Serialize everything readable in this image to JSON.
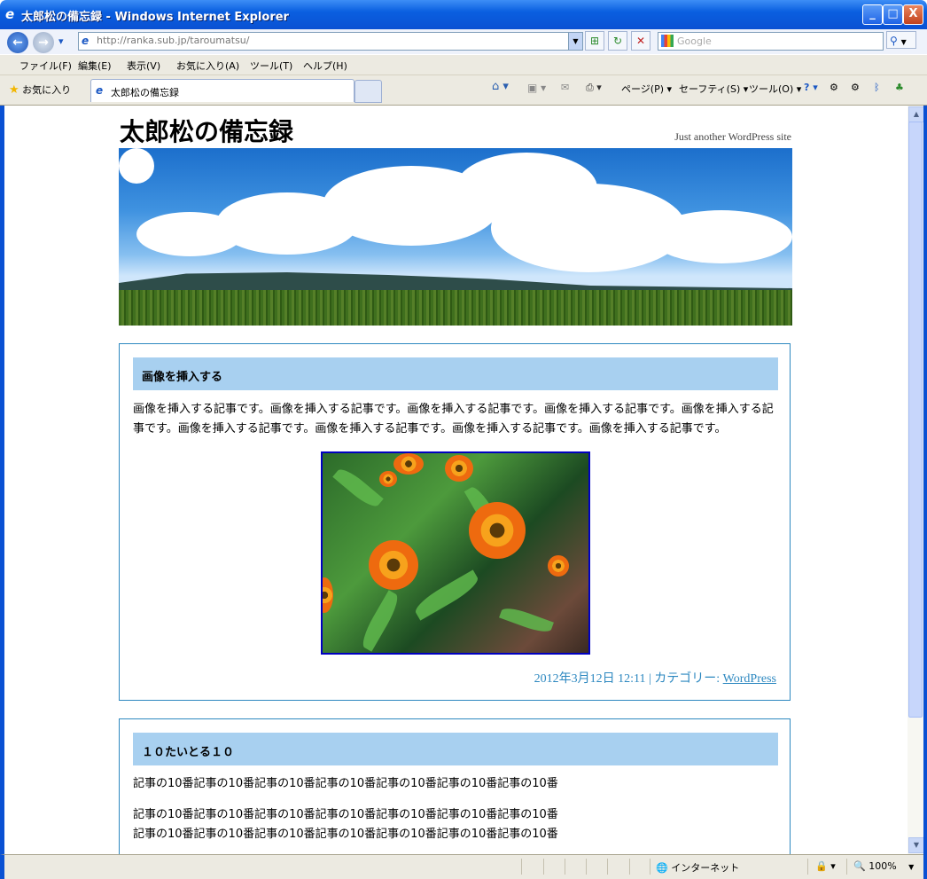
{
  "window": {
    "title": "太郎松の備忘録 - Windows Internet Explorer",
    "ie_logo": "e",
    "min": "_",
    "max": "□",
    "close": "X"
  },
  "nav": {
    "back": "←",
    "forward": "→",
    "history": "▾",
    "address": "http://ranka.sub.jp/taroumatsu/",
    "search_placeholder": "Google"
  },
  "menu": [
    "ファイル(F)",
    "編集(E)",
    "表示(V)",
    "お気に入り(A)",
    "ツール(T)",
    "ヘルプ(H)"
  ],
  "favorites_label": "お気に入り",
  "tab": {
    "label": "太郎松の備忘録"
  },
  "commands": {
    "page": "ページ(P)",
    "safety": "セーフティ(S)",
    "tools": "ツール(O)"
  },
  "site": {
    "title": "太郎松の備忘録",
    "tagline": "Just another WordPress site"
  },
  "posts": [
    {
      "title": "画像を挿入する",
      "body": "画像を挿入する記事です。画像を挿入する記事です。画像を挿入する記事です。画像を挿入する記事です。画像を挿入する記事です。画像を挿入する記事です。画像を挿入する記事です。画像を挿入する記事です。画像を挿入する記事です。",
      "meta_date": "2012年3月12日 12:11 | カテゴリー:",
      "category": "WordPress"
    },
    {
      "title": "１０たいとる１０",
      "lines": [
        "記事の10番記事の10番記事の10番記事の10番記事の10番記事の10番記事の10番",
        "記事の10番記事の10番記事の10番記事の10番記事の10番記事の10番記事の10番",
        "記事の10番記事の10番記事の10番記事の10番記事の10番記事の10番記事の10番"
      ]
    }
  ],
  "status": {
    "zone": "インターネット",
    "zoom": "100%"
  }
}
